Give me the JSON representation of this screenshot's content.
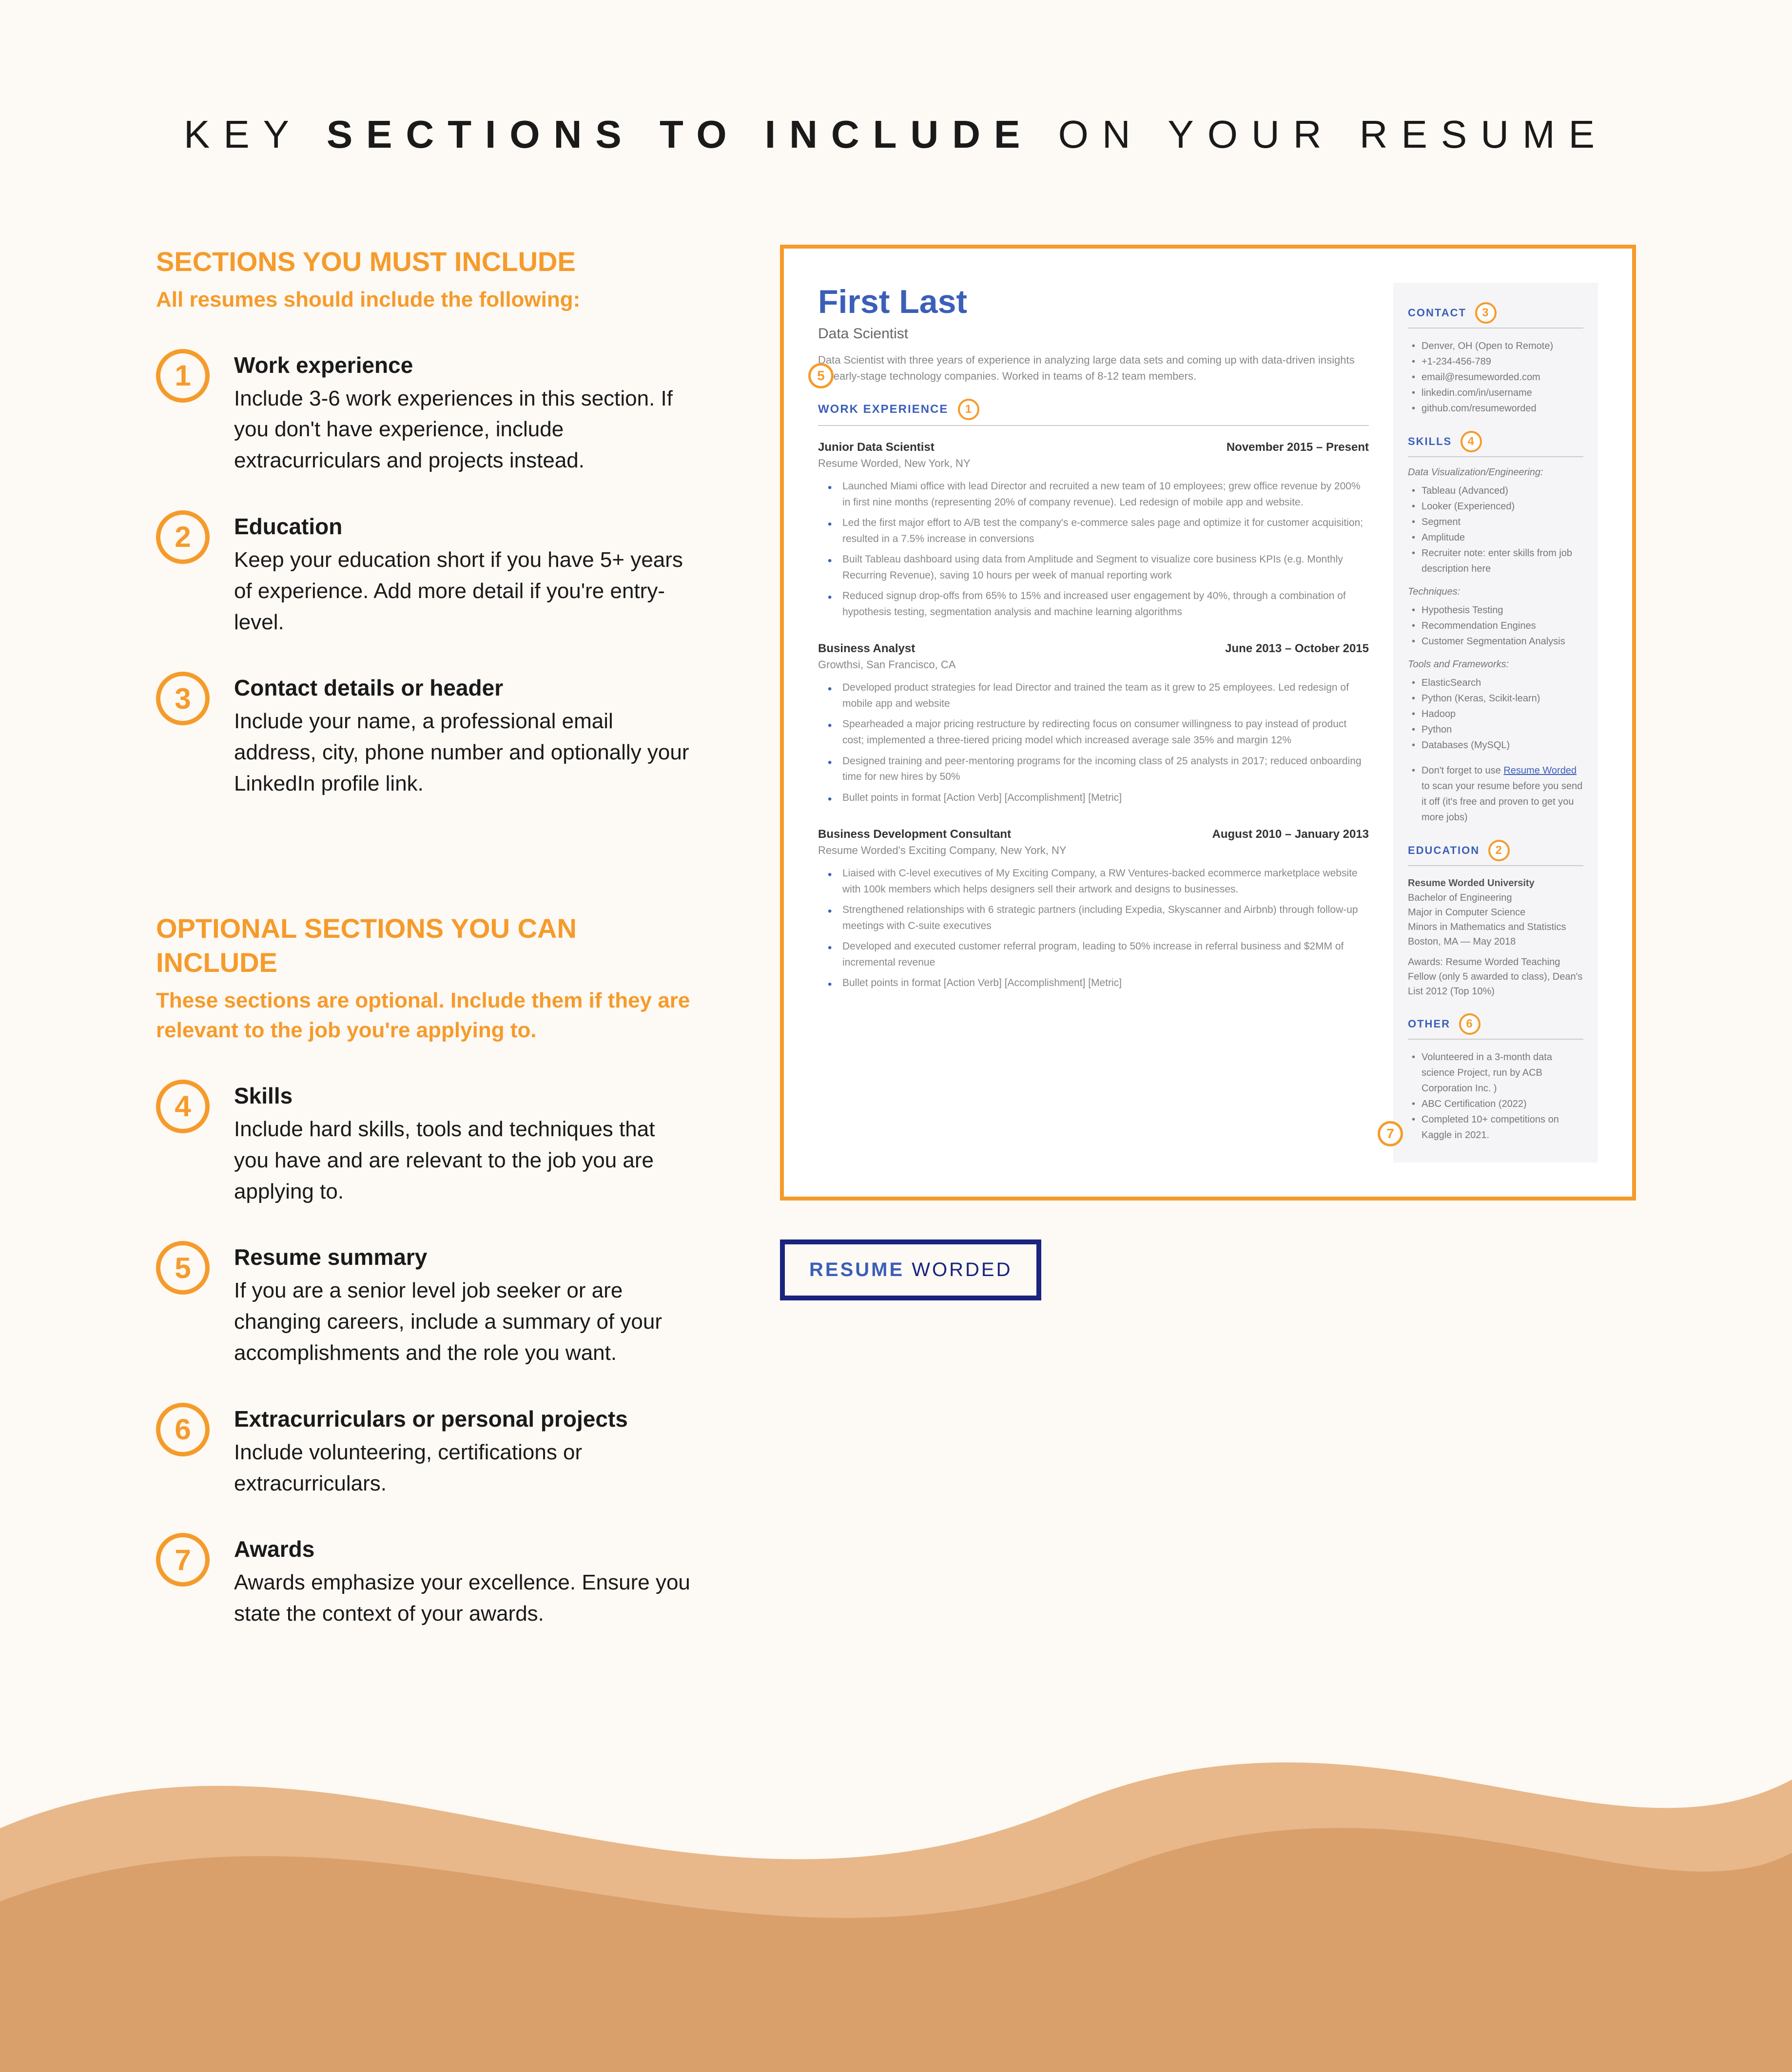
{
  "title": {
    "pre": "KEY ",
    "bold": "SECTIONS TO INCLUDE",
    "post": " ON YOUR RESUME"
  },
  "must": {
    "heading": "SECTIONS YOU MUST INCLUDE",
    "sub": "All resumes should include the following:",
    "items": [
      {
        "n": "1",
        "title": "Work experience",
        "desc": "Include 3-6 work experiences in this section. If you don't have experience, include extracurriculars and projects instead."
      },
      {
        "n": "2",
        "title": "Education",
        "desc": "Keep your education short if you have 5+ years of experience. Add more detail if you're entry-level."
      },
      {
        "n": "3",
        "title": "Contact details or header",
        "desc": "Include your name, a professional email address, city, phone number and optionally your LinkedIn profile link."
      }
    ]
  },
  "optional": {
    "heading": "OPTIONAL SECTIONS YOU CAN INCLUDE",
    "sub": "These sections are optional. Include them if they are relevant to the job you're applying to.",
    "items": [
      {
        "n": "4",
        "title": "Skills",
        "desc": "Include hard skills, tools and techniques that you have and are relevant to the job you are applying to."
      },
      {
        "n": "5",
        "title": "Resume summary",
        "desc": "If you are a senior level job seeker or are changing careers, include a summary of your accomplishments and the role you want."
      },
      {
        "n": "6",
        "title": "Extracurriculars or personal projects",
        "desc": "Include volunteering, certifications or extracurriculars."
      },
      {
        "n": "7",
        "title": "Awards",
        "desc": "Awards emphasize your excellence. Ensure you state the context of your awards."
      }
    ]
  },
  "resume": {
    "name": "First Last",
    "role": "Data Scientist",
    "summary": "Data Scientist with three years of experience in analyzing large data sets and coming up with data-driven insights for early-stage technology companies. Worked in teams of 8-12 team members.",
    "work_label": "WORK EXPERIENCE",
    "jobs": [
      {
        "title": "Junior Data Scientist",
        "dates": "November 2015 – Present",
        "company": "Resume Worded, New York, NY",
        "bullets": [
          "Launched Miami office with lead Director and recruited a new team of 10 employees; grew office revenue by 200% in first nine months (representing 20% of company revenue). Led redesign of mobile app and website.",
          "Led the first major effort to A/B test the company's e-commerce sales page and optimize it for customer acquisition; resulted in a 7.5% increase in conversions",
          "Built Tableau dashboard using data from Amplitude and Segment to visualize core business KPIs (e.g. Monthly Recurring Revenue), saving 10 hours per week of manual reporting work",
          "Reduced signup drop-offs from 65% to 15% and increased user engagement by 40%, through a combination of hypothesis testing, segmentation analysis and machine learning algorithms"
        ]
      },
      {
        "title": "Business Analyst",
        "dates": "June 2013 – October 2015",
        "company": "Growthsi, San Francisco, CA",
        "bullets": [
          "Developed product strategies for lead Director and trained the team as it grew to 25 employees. Led redesign of mobile app and website",
          "Spearheaded a major pricing restructure by redirecting focus on consumer willingness to pay instead of product cost; implemented a three-tiered pricing model which increased average sale 35% and margin 12%",
          "Designed training and peer-mentoring programs for the incoming class of 25 analysts in 2017; reduced onboarding time for new hires by 50%",
          "Bullet points in format [Action Verb] [Accomplishment] [Metric]"
        ]
      },
      {
        "title": "Business Development Consultant",
        "dates": "August 2010 – January 2013",
        "company": "Resume Worded's Exciting Company, New York, NY",
        "bullets": [
          "Liaised with C-level executives of My Exciting Company, a RW Ventures-backed ecommerce marketplace website with 100k members which helps designers sell their artwork and designs to businesses.",
          "Strengthened relationships with 6 strategic partners (including Expedia, Skyscanner and Airbnb) through follow-up meetings with C-suite executives",
          "Developed and executed customer referral program, leading to 50% increase in referral business and $2MM of incremental revenue",
          "Bullet points in format [Action Verb] [Accomplishment] [Metric]"
        ]
      }
    ],
    "side": {
      "contact_label": "CONTACT",
      "contact": [
        "Denver, OH (Open to Remote)",
        "+1-234-456-789",
        "email@resumeworded.com",
        "linkedin.com/in/username",
        "github.com/resumeworded"
      ],
      "skills_label": "SKILLS",
      "skills_groups": [
        {
          "title": "Data Visualization/Engineering:",
          "items": [
            "Tableau (Advanced)",
            "Looker (Experienced)",
            "Segment",
            "Amplitude",
            "Recruiter note: enter skills from job description here"
          ]
        },
        {
          "title": "Techniques:",
          "items": [
            "Hypothesis Testing",
            "Recommendation Engines",
            "Customer Segmentation Analysis"
          ]
        },
        {
          "title": "Tools and Frameworks:",
          "items": [
            "ElasticSearch",
            "Python (Keras, Scikit-learn)",
            "Hadoop",
            "Python",
            "Databases (MySQL)"
          ]
        }
      ],
      "note_pre": "Don't forget to use ",
      "note_link": "Resume Worded",
      "note_post": " to scan your resume before you send it off (it's free and proven to get you more jobs)",
      "education_label": "EDUCATION",
      "edu": {
        "school": "Resume Worded University",
        "degree": "Bachelor of Engineering",
        "major": "Major in Computer Science",
        "minor": "Minors in Mathematics and Statistics",
        "loc": "Boston, MA — May 2018",
        "awards": "Awards: Resume Worded Teaching Fellow (only 5 awarded to class), Dean's List 2012 (Top 10%)"
      },
      "other_label": "OTHER",
      "other": [
        "Volunteered in a 3-month data science Project, run by ACB Corporation Inc. )",
        "ABC Certification (2022)",
        "Completed 10+ competitions on Kaggle in 2021."
      ]
    }
  },
  "logo": {
    "part1": "RESUME",
    "part2": "WORDED"
  }
}
